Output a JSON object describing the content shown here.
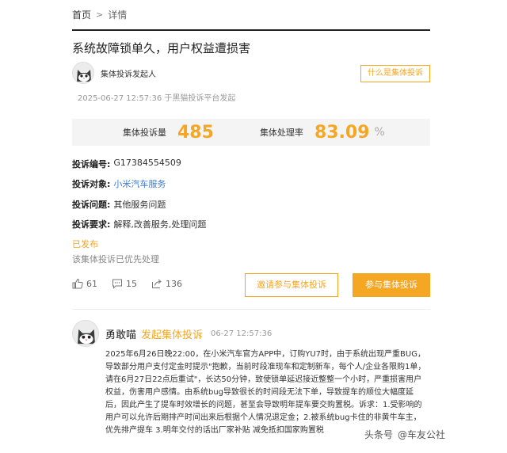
{
  "breadcrumb": {
    "home": "首页",
    "separator": ">",
    "current": "详情"
  },
  "title": "系统故障锁单久，用户权益遭损害",
  "initiator": {
    "name": "集体投诉发起人",
    "avatar_icon": "cat-avatar-icon"
  },
  "what_button": "什么是集体投诉",
  "launch_time": "2025-06-27 12:57:36 于黑猫投诉平台发起",
  "stats": {
    "count_label": "集体投诉量",
    "count_value": "485",
    "rate_label": "集体处理率",
    "rate_value": "83.09",
    "rate_unit": "%"
  },
  "details": [
    {
      "key": "投诉编号:",
      "value": "G17384554509"
    },
    {
      "key": "投诉对象:",
      "value": "小米汽车服务"
    },
    {
      "key": "投诉问题:",
      "value": "其他服务问题"
    },
    {
      "key": "投诉要求:",
      "value": "解释,改善服务,处理问题"
    }
  ],
  "status": "已发布",
  "note": "该集体投诉已优先处理",
  "actions": {
    "likes": "61",
    "comments": "15",
    "shares": "136"
  },
  "buttons": {
    "invite": "邀请参与集体投诉",
    "join": "参与集体投诉"
  },
  "post": {
    "name": "勇敢喵",
    "action": "发起集体投诉",
    "time": "06-27 12:57:36",
    "body": "2025年6月26日晚22:00，在小米汽车官方APP中，订购YU7时，由于系统出现严重BUG，导致部分用户支付定金时提示\"抱歉，当前时段准现车和定制新车，每个人/企业各限购1单，请在6月27日22点后重试\"，长达50分钟，致使锁单延迟接近整整一个小时，严重损害用户权益，伤害用户感情。由系统bug导致很长的时间段无法下单，导致提车的顺位大幅度延后，因此产生了提车时效增长的问题，甚至会导致明年提车要交购置税。诉求：1.受影响的用户可以允许后期排产时间出来后根据个人情况退定金；2.被系统bug卡住的非黄牛车主，优先排产提车 3.明年交付的话出厂家补贴 减免抵扣国家购置税"
  },
  "watermark": {
    "source": "头条号",
    "author": "@车友公社"
  },
  "colors": {
    "accent": "#f5a623",
    "link": "#3a7bd5"
  }
}
